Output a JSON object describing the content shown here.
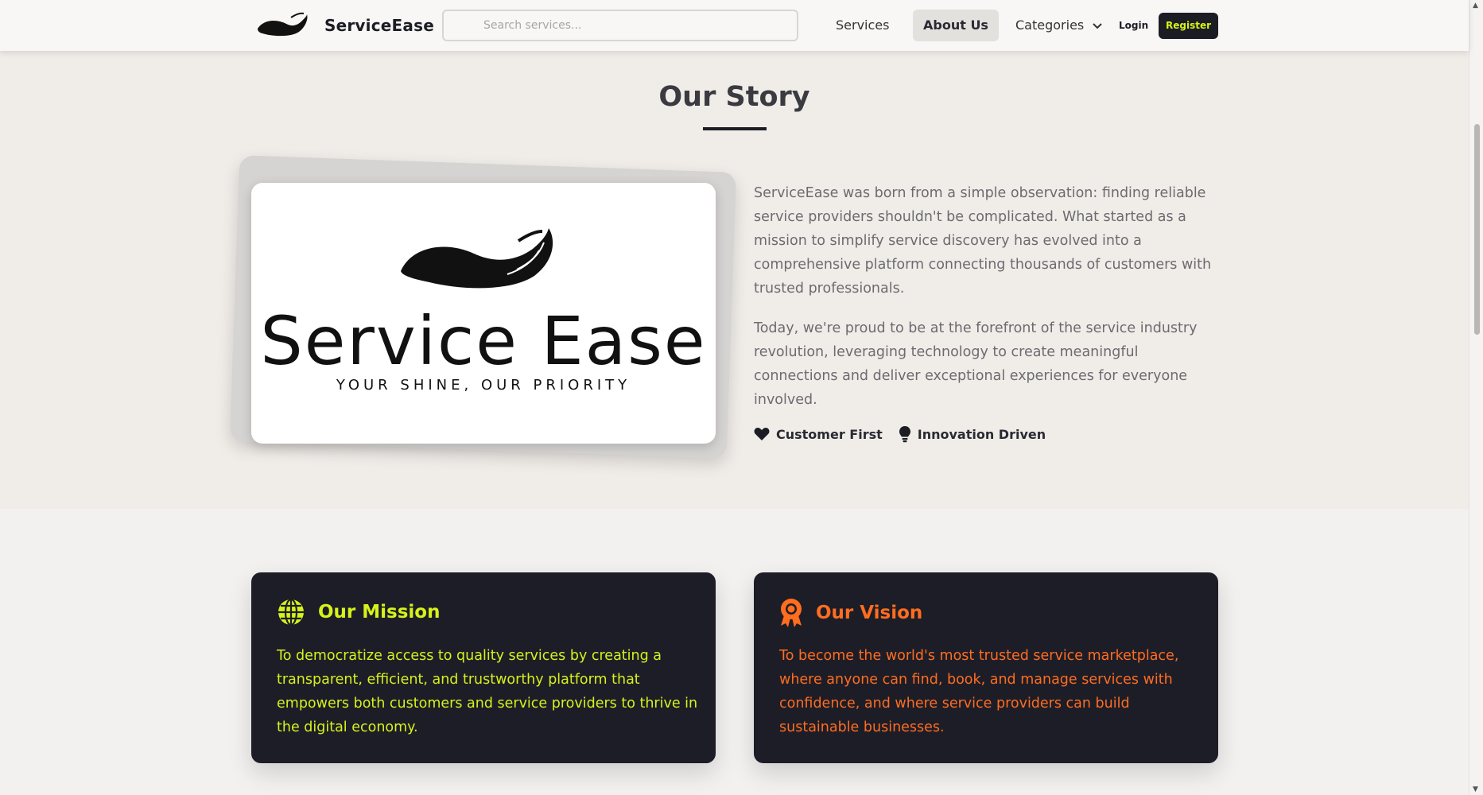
{
  "nav": {
    "brand_name": "ServiceEase",
    "search_placeholder": "Search services...",
    "links": {
      "services": "Services",
      "about": "About Us",
      "categories": "Categories"
    },
    "login": "Login",
    "register": "Register"
  },
  "story": {
    "title": "Our Story",
    "image": {
      "logo_text": "Service Ease",
      "tagline": "YOUR SHINE, OUR PRIORITY"
    },
    "paragraphs": [
      "ServiceEase was born from a simple observation: finding reliable service providers shouldn't be complicated. What started as a mission to simplify service discovery has evolved into a comprehensive platform connecting thousands of customers with trusted professionals.",
      "Today, we're proud to be at the forefront of the service industry revolution, leveraging technology to create meaningful connections and deliver exceptional experiences for everyone involved."
    ],
    "badges": [
      {
        "label": "Customer First",
        "icon": "heart-icon"
      },
      {
        "label": "Innovation Driven",
        "icon": "lightbulb-icon"
      }
    ]
  },
  "mission": {
    "title": "Our Mission",
    "icon": "globe-icon",
    "text": "To democratize access to quality services by creating a transparent, efficient, and trustworthy platform that empowers both customers and service providers to thrive in the digital economy."
  },
  "vision": {
    "title": "Our Vision",
    "icon": "award-icon",
    "text": "To become the world's most trusted service marketplace, where anyone can find, book, and manage services with confidence, and where service providers can build sustainable businesses."
  },
  "colors": {
    "dark": "#1c1c24",
    "lime_accent": "#d6f21a",
    "orange_accent": "#ff6d1f",
    "story_bg": "#f0ece8"
  }
}
